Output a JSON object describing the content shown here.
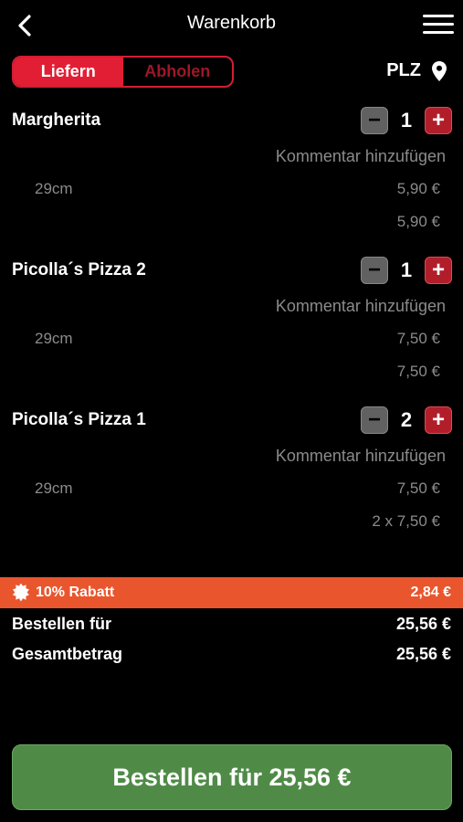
{
  "header": {
    "title": "Warenkorb"
  },
  "toggle": {
    "deliver": "Liefern",
    "pickup": "Abholen"
  },
  "plz_label": "PLZ",
  "items": [
    {
      "name": "Margherita",
      "qty": "1",
      "comment": "Kommentar hinzufügen",
      "size": "29cm",
      "unit_price": "5,90 €",
      "total": "5,90 €"
    },
    {
      "name": "Picolla´s Pizza 2",
      "qty": "1",
      "comment": "Kommentar hinzufügen",
      "size": "29cm",
      "unit_price": "7,50 €",
      "total": "7,50 €"
    },
    {
      "name": "Picolla´s Pizza 1",
      "qty": "2",
      "comment": "Kommentar hinzufügen",
      "size": "29cm",
      "unit_price": "7,50 €",
      "total": "2 x 7,50 €"
    }
  ],
  "discount": {
    "label": "10% Rabatt",
    "amount": "2,84 €"
  },
  "summary": {
    "order_for_label": "Bestellen für",
    "order_for_value": "25,56 €",
    "total_label": "Gesamtbetrag",
    "total_value": "25,56 €"
  },
  "order_button": "Bestellen für 25,56 €",
  "colors": {
    "accent_red": "#e21e35",
    "discount_orange": "#e9562d",
    "order_green": "#4f8b47"
  }
}
